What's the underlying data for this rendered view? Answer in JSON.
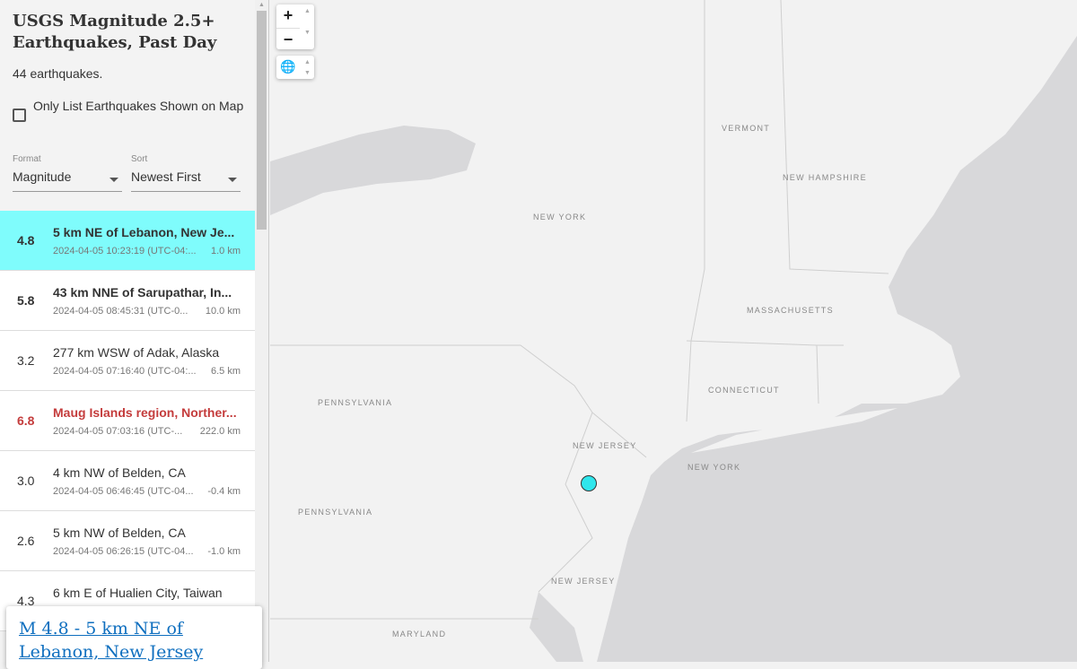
{
  "sidebar": {
    "title": "USGS Magnitude 2.5+ Earthquakes, Past Day",
    "count": "44 earthquakes.",
    "only_list_label": "Only List Earthquakes Shown on Map",
    "only_list_checked": false,
    "format": {
      "label": "Format",
      "value": "Magnitude"
    },
    "sort": {
      "label": "Sort",
      "value": "Newest First"
    },
    "items": [
      {
        "mag": "4.8",
        "title": "5 km NE of Lebanon, New Je...",
        "time": "2024-04-05 10:23:19 (UTC-04:...",
        "depth": "1.0 km"
      },
      {
        "mag": "5.8",
        "title": "43 km NNE of Sarupathar, In...",
        "time": "2024-04-05 08:45:31 (UTC-0...",
        "depth": "10.0 km"
      },
      {
        "mag": "3.2",
        "title": "277 km WSW of Adak, Alaska",
        "time": "2024-04-05 07:16:40 (UTC-04:...",
        "depth": "6.5 km"
      },
      {
        "mag": "6.8",
        "title": "Maug Islands region, Norther...",
        "time": "2024-04-05 07:03:16 (UTC-...",
        "depth": "222.0 km"
      },
      {
        "mag": "3.0",
        "title": "4 km NW of Belden, CA",
        "time": "2024-04-05 06:46:45 (UTC-04...",
        "depth": "-0.4 km"
      },
      {
        "mag": "2.6",
        "title": "5 km NW of Belden, CA",
        "time": "2024-04-05 06:26:15 (UTC-04...",
        "depth": "-1.0 km"
      },
      {
        "mag": "4.3",
        "title": "6 km E of Hualien City, Taiwan",
        "time": "",
        "depth": ""
      }
    ]
  },
  "popup": {
    "link": "M 4.8 - 5 km NE of Lebanon, New Jersey"
  },
  "map": {
    "zoom_in": "+",
    "zoom_out": "−",
    "labels": [
      "VERMONT",
      "NEW HAMPSHIRE",
      "NEW YORK",
      "MASSACHUSETTS",
      "CONNECTICUT",
      "PENNSYLVANIA",
      "NEW JERSEY",
      "NEW YORK",
      "PENNSYLVANIA",
      "NEW JERSEY",
      "MARYLAND"
    ],
    "colors": {
      "selected": "#7ffcfc",
      "marker": "#2fe6ec",
      "alert": "#c43c3c",
      "water": "#d8d8da",
      "land": "#f2f2f2"
    }
  }
}
